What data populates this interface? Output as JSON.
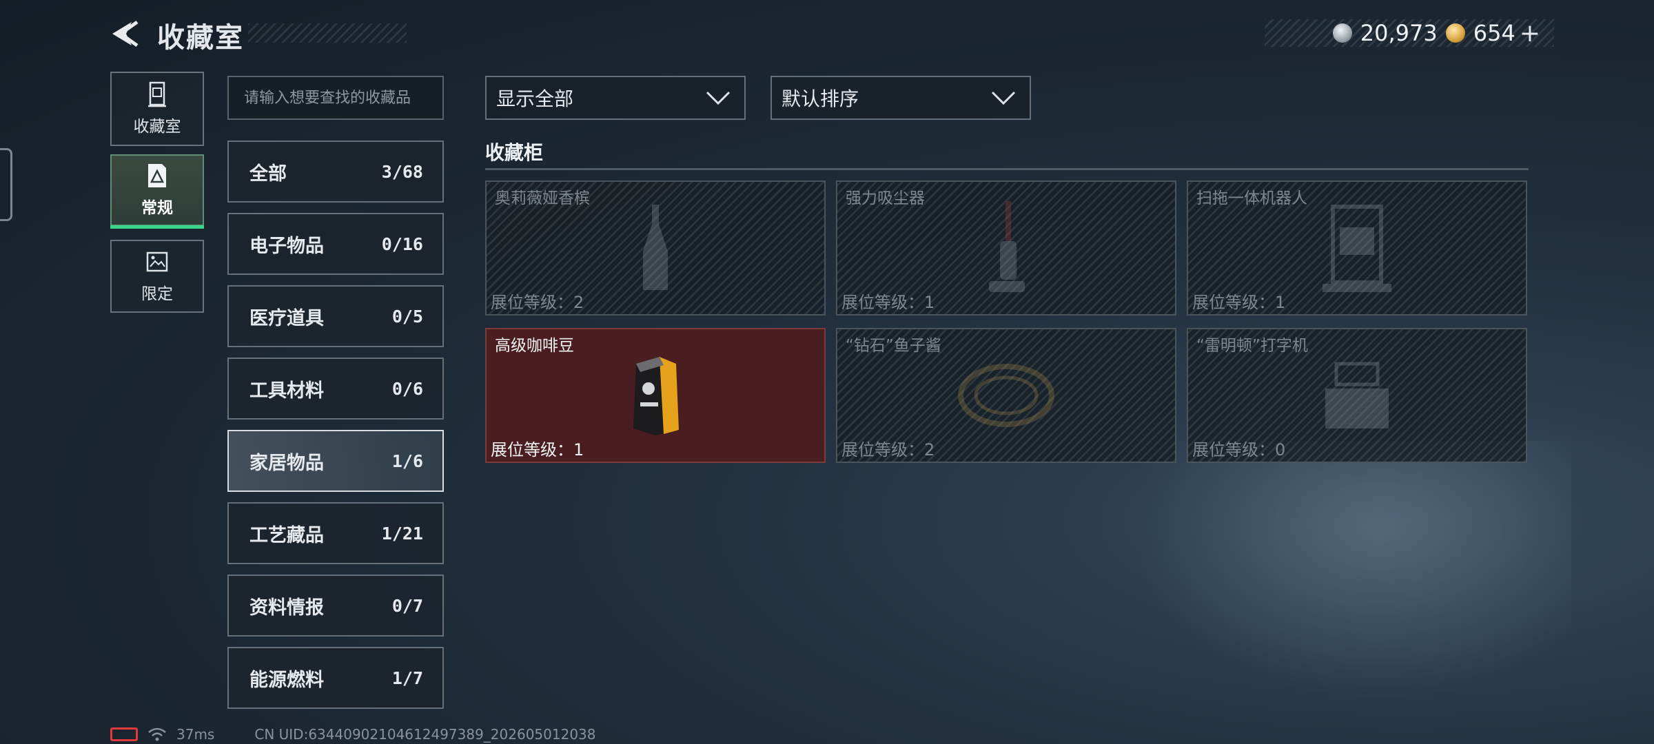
{
  "header": {
    "title": "收藏室",
    "currency": [
      {
        "icon": "silver-coin-icon",
        "value": "20,973"
      },
      {
        "icon": "gold-coin-icon",
        "value": "654"
      }
    ],
    "plus": "+"
  },
  "side_tabs": [
    {
      "label": "收藏室",
      "icon": "display-cabinet-icon",
      "active": false
    },
    {
      "label": "常规",
      "icon": "document-triangle-icon",
      "active": true
    },
    {
      "label": "限定",
      "icon": "limited-picture-icon",
      "active": false
    }
  ],
  "search": {
    "placeholder": "请输入想要查找的收藏品"
  },
  "categories": [
    {
      "name": "全部",
      "count": "3/68"
    },
    {
      "name": "电子物品",
      "count": "0/16"
    },
    {
      "name": "医疗道具",
      "count": "0/5"
    },
    {
      "name": "工具材料",
      "count": "0/6"
    },
    {
      "name": "家居物品",
      "count": "1/6",
      "selected": true
    },
    {
      "name": "工艺藏品",
      "count": "1/21"
    },
    {
      "name": "资料情报",
      "count": "0/7"
    },
    {
      "name": "能源燃料",
      "count": "1/7"
    }
  ],
  "filters": {
    "display": "显示全部",
    "sort": "默认排序"
  },
  "section_title": "收藏柜",
  "cards": [
    {
      "name": "奥莉薇娅香槟",
      "level": "展位等级：2",
      "owned": false,
      "icon": "champagne-bottle-icon"
    },
    {
      "name": "强力吸尘器",
      "level": "展位等级：1",
      "owned": false,
      "icon": "vacuum-cleaner-icon"
    },
    {
      "name": "扫拖一体机器人",
      "level": "展位等级：1",
      "owned": false,
      "icon": "robot-station-icon"
    },
    {
      "name": "高级咖啡豆",
      "level": "展位等级：1",
      "owned": true,
      "icon": "coffee-bean-bag-icon"
    },
    {
      "name": "“钻石”鱼子酱",
      "level": "展位等级：2",
      "owned": false,
      "icon": "caviar-tin-icon"
    },
    {
      "name": "“雷明顿”打字机",
      "level": "展位等级：0",
      "owned": false,
      "icon": "typewriter-icon"
    }
  ],
  "status": {
    "ping": "37ms",
    "uid": "CN UID:6344090210461249738​9_202605012038"
  },
  "colors": {
    "accent_green": "#39d58a",
    "owned_card_bg": "#4a1d20",
    "battery_red": "#e33b3b"
  }
}
